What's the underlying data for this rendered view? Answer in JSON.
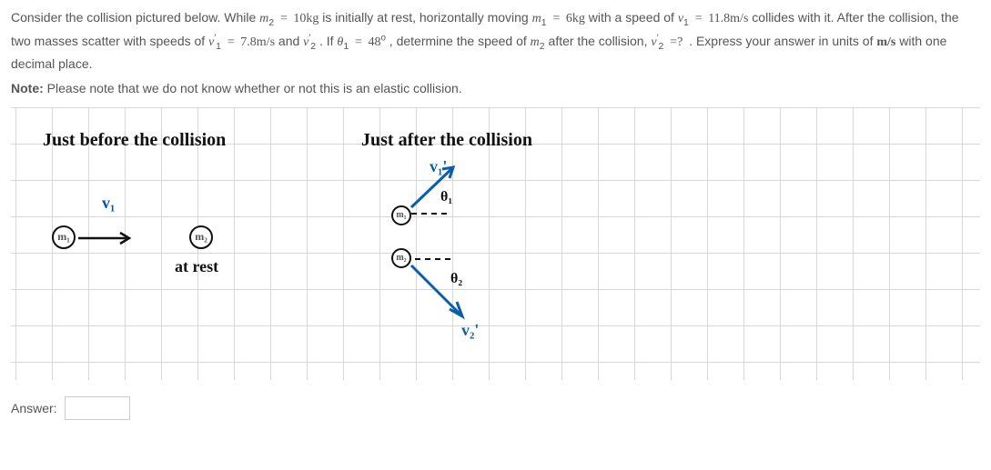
{
  "problem": {
    "intro": "Consider the collision pictured below. While ",
    "m2_var": "m",
    "m2_sub": "2",
    "eq": " = ",
    "m2_val": "10",
    "m2_unit": "kg",
    "mid1": " is initially at rest, horizontally moving ",
    "m1_var": "m",
    "m1_sub": "1",
    "m1_val": "6",
    "m1_unit": "kg",
    "mid2": " with a speed of ",
    "v1_var": "v",
    "v1_sub": "1",
    "v1_val": "11.8",
    "v1_unit": "m/s",
    "mid3": " collides with it. After the collision, the two masses scatter with speeds of ",
    "v1p_var": "v",
    "v1p_prime": "′",
    "v1p_sub": "1",
    "v1p_val": "7.8",
    "v1p_unit": "m/s",
    "mid4": " and ",
    "v2p_var": "v",
    "v2p_prime": "′",
    "v2p_sub": "2",
    "mid5": ". If ",
    "th1_var": "θ",
    "th1_sub": "1",
    "th1_val": "48",
    "deg": "o",
    "mid6": ", determine the speed of ",
    "m2b_var": "m",
    "m2b_sub": "2",
    "mid7": " after the collision, ",
    "v2pb_var": "v",
    "v2pb_prime": "′",
    "v2pb_sub": "2",
    "q": " =?",
    "mid8": ". Express your answer in units of ",
    "ans_unit": "m/s",
    "mid9": " with one decimal place."
  },
  "note": {
    "label": "Note:",
    "text": " Please note that we do not know whether or not this is an elastic collision."
  },
  "diagram": {
    "before_title": "Just before the collision",
    "after_title": "Just after the collision",
    "m1_label": "m₁",
    "m2_label": "m₂",
    "v1_label": "v₁",
    "v1p_label": "v₁'",
    "v2p_label": "v₂'",
    "th1_label": "θ₁",
    "th2_label": "θ₂",
    "at_rest": "at rest"
  },
  "answer": {
    "label": "Answer:",
    "placeholder": ""
  }
}
